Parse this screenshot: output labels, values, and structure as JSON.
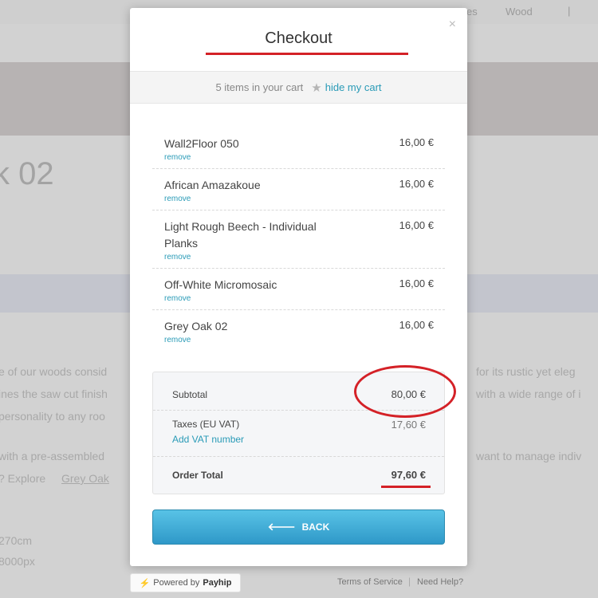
{
  "background": {
    "nav": {
      "woods": "Wood",
      "sep": "|",
      "other": "es"
    },
    "title": "k 02",
    "lines": [
      "e of our woods consid",
      "ines the saw cut finish",
      "personality to any roo",
      "with a pre-assembled",
      "? Explore",
      "Grey Oak",
      "for its rustic yet eleg",
      "with a wide range of i",
      "want to manage indiv",
      "270cm",
      "8000px"
    ]
  },
  "modal": {
    "title": "Checkout",
    "close_icon": "×",
    "cart_summary": {
      "count_text": "5 items in your cart",
      "star_icon": "★",
      "hide_label": "hide my cart"
    },
    "items": [
      {
        "name": "Wall2Floor 050",
        "price": "16,00 €",
        "remove": "remove"
      },
      {
        "name": "African Amazakoue",
        "price": "16,00 €",
        "remove": "remove"
      },
      {
        "name": "Light Rough Beech - Individual Planks",
        "price": "16,00 €",
        "remove": "remove"
      },
      {
        "name": "Off-White Micromosaic",
        "price": "16,00 €",
        "remove": "remove"
      },
      {
        "name": "Grey Oak 02",
        "price": "16,00 €",
        "remove": "remove"
      }
    ],
    "totals": {
      "subtotal_label": "Subtotal",
      "subtotal_value": "80,00 €",
      "taxes_label": "Taxes (EU VAT)",
      "taxes_value": "17,60 €",
      "add_vat_label": "Add VAT number",
      "order_total_label": "Order Total",
      "order_total_value": "97,60 €"
    },
    "back_button": {
      "icon": "🡐",
      "label": "BACK"
    }
  },
  "footer": {
    "bolt_icon": "⚡",
    "powered_by": "Powered by",
    "brand": "Payhip",
    "terms": "Terms of Service",
    "sep": "|",
    "help": "Need Help?"
  },
  "colors": {
    "accent": "#2a9bb7",
    "annotation_red": "#d42127",
    "button_top": "#58c3e6",
    "button_bottom": "#2f98c8"
  }
}
